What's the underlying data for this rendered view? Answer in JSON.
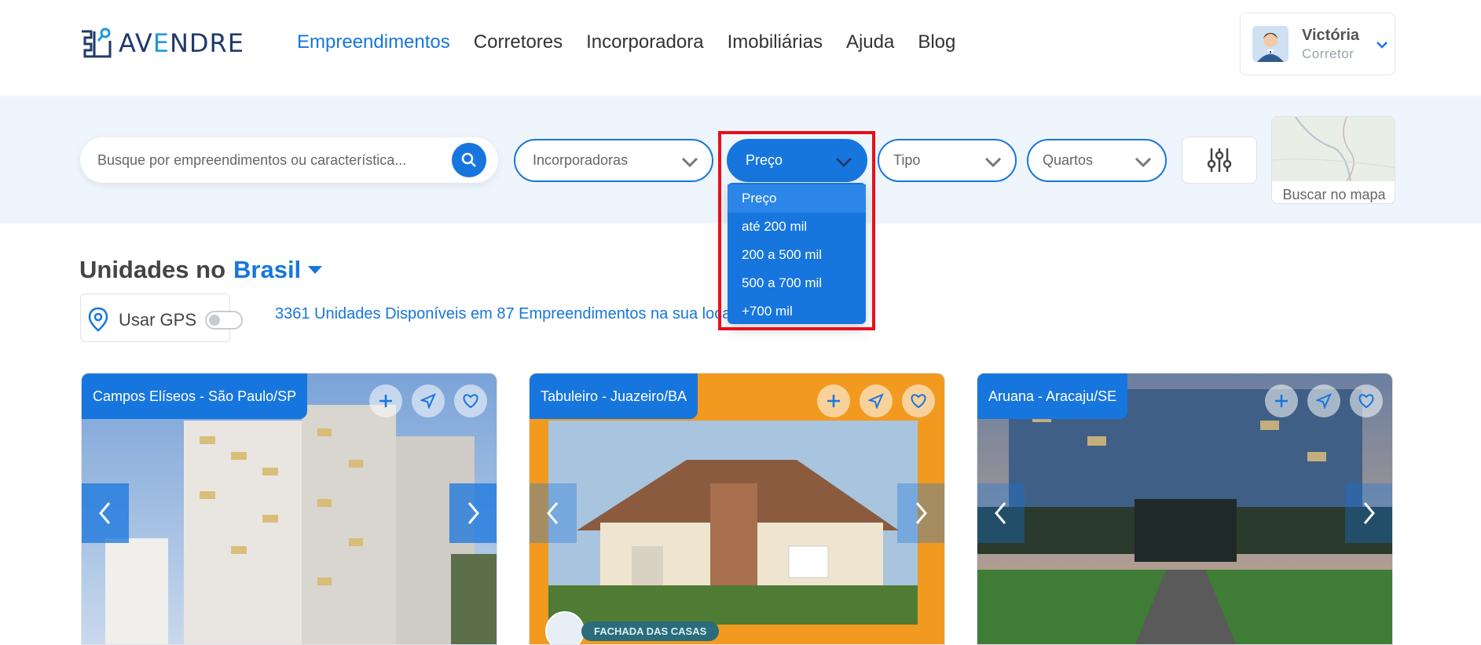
{
  "brand": {
    "logo_text_a": "AV",
    "logo_text_e": "E",
    "logo_text_b": "NDRE"
  },
  "nav": {
    "items": [
      {
        "label": "Empreendimentos",
        "active": true
      },
      {
        "label": "Corretores"
      },
      {
        "label": "Incorporadora"
      },
      {
        "label": "Imobiliárias"
      },
      {
        "label": "Ajuda"
      },
      {
        "label": "Blog"
      }
    ]
  },
  "user": {
    "name": "Victória",
    "role": "Corretor"
  },
  "filters": {
    "search_placeholder": "Busque por empreendimentos ou característica...",
    "incorporadoras": "Incorporadoras",
    "preco": "Preço",
    "tipo": "Tipo",
    "quartos": "Quartos",
    "map_label": "Buscar no mapa"
  },
  "price_dropdown": {
    "options": [
      "Preço",
      "até 200 mil",
      "200 a 500 mil",
      "500 a 700 mil",
      "+700 mil"
    ],
    "selected": "Preço"
  },
  "section": {
    "title_prefix": "Unidades no",
    "location": "Brasil",
    "gps_label": "Usar GPS",
    "available_text": "3361 Unidades Disponíveis em 87 Empreendimentos na sua loca"
  },
  "cards": [
    {
      "tag": "Campos Elíseos - São Paulo/SP"
    },
    {
      "tag": "Tabuleiro - Juazeiro/BA",
      "badge": "FACHADA DAS CASAS"
    },
    {
      "tag": "Aruana - Aracaju/SE"
    }
  ],
  "colors": {
    "accent": "#1776dd",
    "highlight": "#e8101a"
  }
}
